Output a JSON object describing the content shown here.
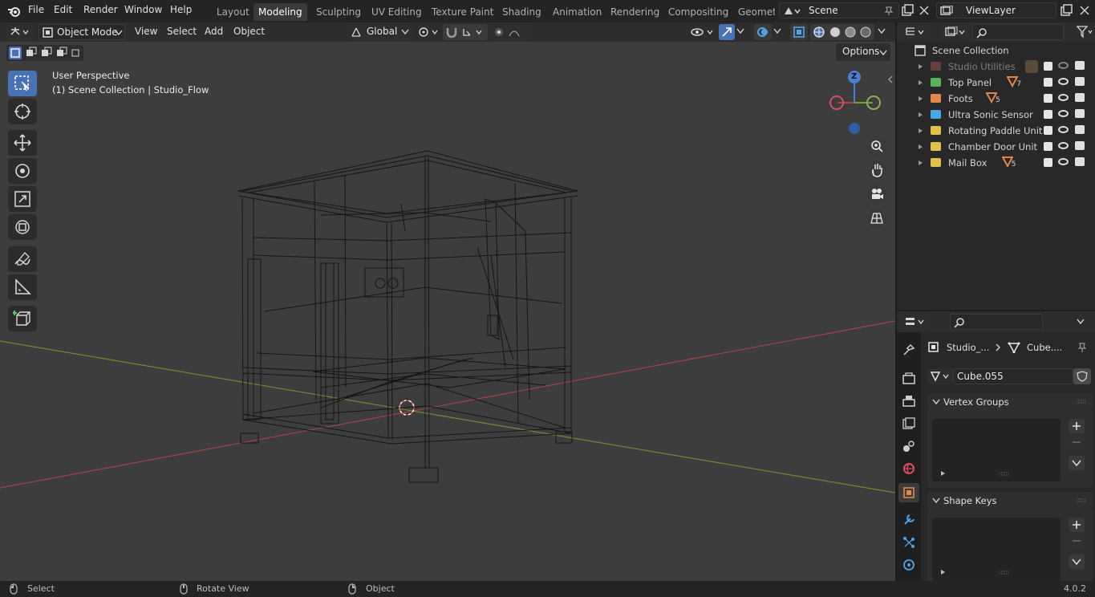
{
  "topbar": {
    "menus": [
      "File",
      "Edit",
      "Render",
      "Window",
      "Help"
    ],
    "workspaces": [
      "Layout",
      "Modeling",
      "Sculpting",
      "UV Editing",
      "Texture Paint",
      "Shading",
      "Animation",
      "Rendering",
      "Compositing",
      "Geomet"
    ],
    "active_workspace": "Modeling",
    "scene": "Scene",
    "view_layer": "ViewLayer"
  },
  "viewport_header": {
    "mode": "Object Mode",
    "menus": [
      "View",
      "Select",
      "Add",
      "Object"
    ],
    "transform_orientation": "Global",
    "options_label": "Options"
  },
  "viewport": {
    "perspective_label": "User Perspective",
    "collection_label": "(1) Scene Collection | Studio_Flow",
    "gizmo_axes": {
      "z": "Z"
    },
    "colors": {
      "background": "#3d3d3d",
      "x_axis": "#b34150",
      "y_axis": "#7c9a3a",
      "accent": "#4772b3"
    }
  },
  "tools": [
    "select-box-tool",
    "cursor-tool",
    "move-tool",
    "rotate-tool",
    "scale-tool",
    "transform-tool",
    "annotate-tool",
    "measure-tool",
    "add-cube-tool"
  ],
  "outliner": {
    "root": "Scene Collection",
    "items": [
      {
        "label": "Studio Utilities",
        "color": "#b35a5a",
        "badge": "",
        "dim": true
      },
      {
        "label": "Top Panel",
        "color": "#5ab35a",
        "badge": "7",
        "dim": false
      },
      {
        "label": "Foots",
        "color": "#e0884a",
        "badge": "5",
        "dim": false
      },
      {
        "label": "Ultra Sonic Sensor",
        "color": "#4aa8e0",
        "badge": "",
        "dim": false
      },
      {
        "label": "Rotating Paddle Unit",
        "color": "#e0c24a",
        "badge": "",
        "dim": false
      },
      {
        "label": "Chamber Door Unit",
        "color": "#e0c24a",
        "badge": "",
        "dim": false
      },
      {
        "label": "Mail Box",
        "color": "#e0c24a",
        "badge": "5",
        "dim": false
      }
    ]
  },
  "properties": {
    "breadcrumb_object": "Studio_...",
    "breadcrumb_data": "Cube....",
    "mesh_name": "Cube.055",
    "panels": [
      "Vertex Groups",
      "Shape Keys"
    ]
  },
  "statusbar": {
    "items": [
      "Select",
      "Rotate View",
      "Object"
    ],
    "version": "4.0.2"
  }
}
